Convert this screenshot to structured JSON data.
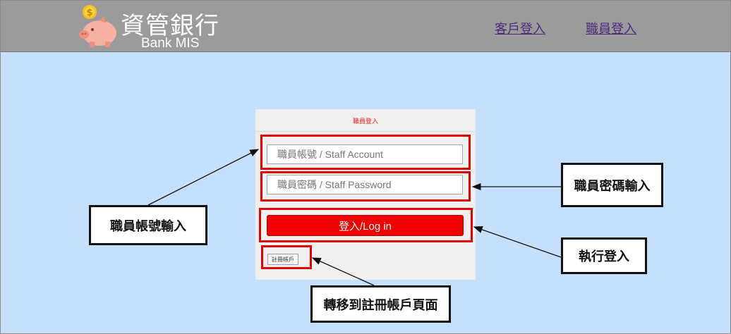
{
  "header": {
    "brand_title": "資管銀行",
    "brand_subtitle": "Bank MIS",
    "nav": {
      "customer_login": "客戶登入",
      "staff_login": "職員登入"
    }
  },
  "login_panel": {
    "title": "職員登入",
    "account_placeholder": "職員帳號 / Staff Account",
    "password_placeholder": "職員密碼 / Staff Password",
    "login_button": "登入/Log in",
    "register_button": "註冊帳戶"
  },
  "annotations": {
    "account_input": "職員帳號輸入",
    "password_input": "職員密碼輸入",
    "login_action": "執行登入",
    "register_redirect": "轉移到註冊帳戶頁面"
  },
  "colors": {
    "background": "#c5e0fd",
    "header": "#9b9b9b",
    "accent_red": "#f00000",
    "highlight_red": "#e60000",
    "link": "#4b2a7f"
  },
  "icons": {
    "logo": "piggy-bank-coin-icon"
  }
}
